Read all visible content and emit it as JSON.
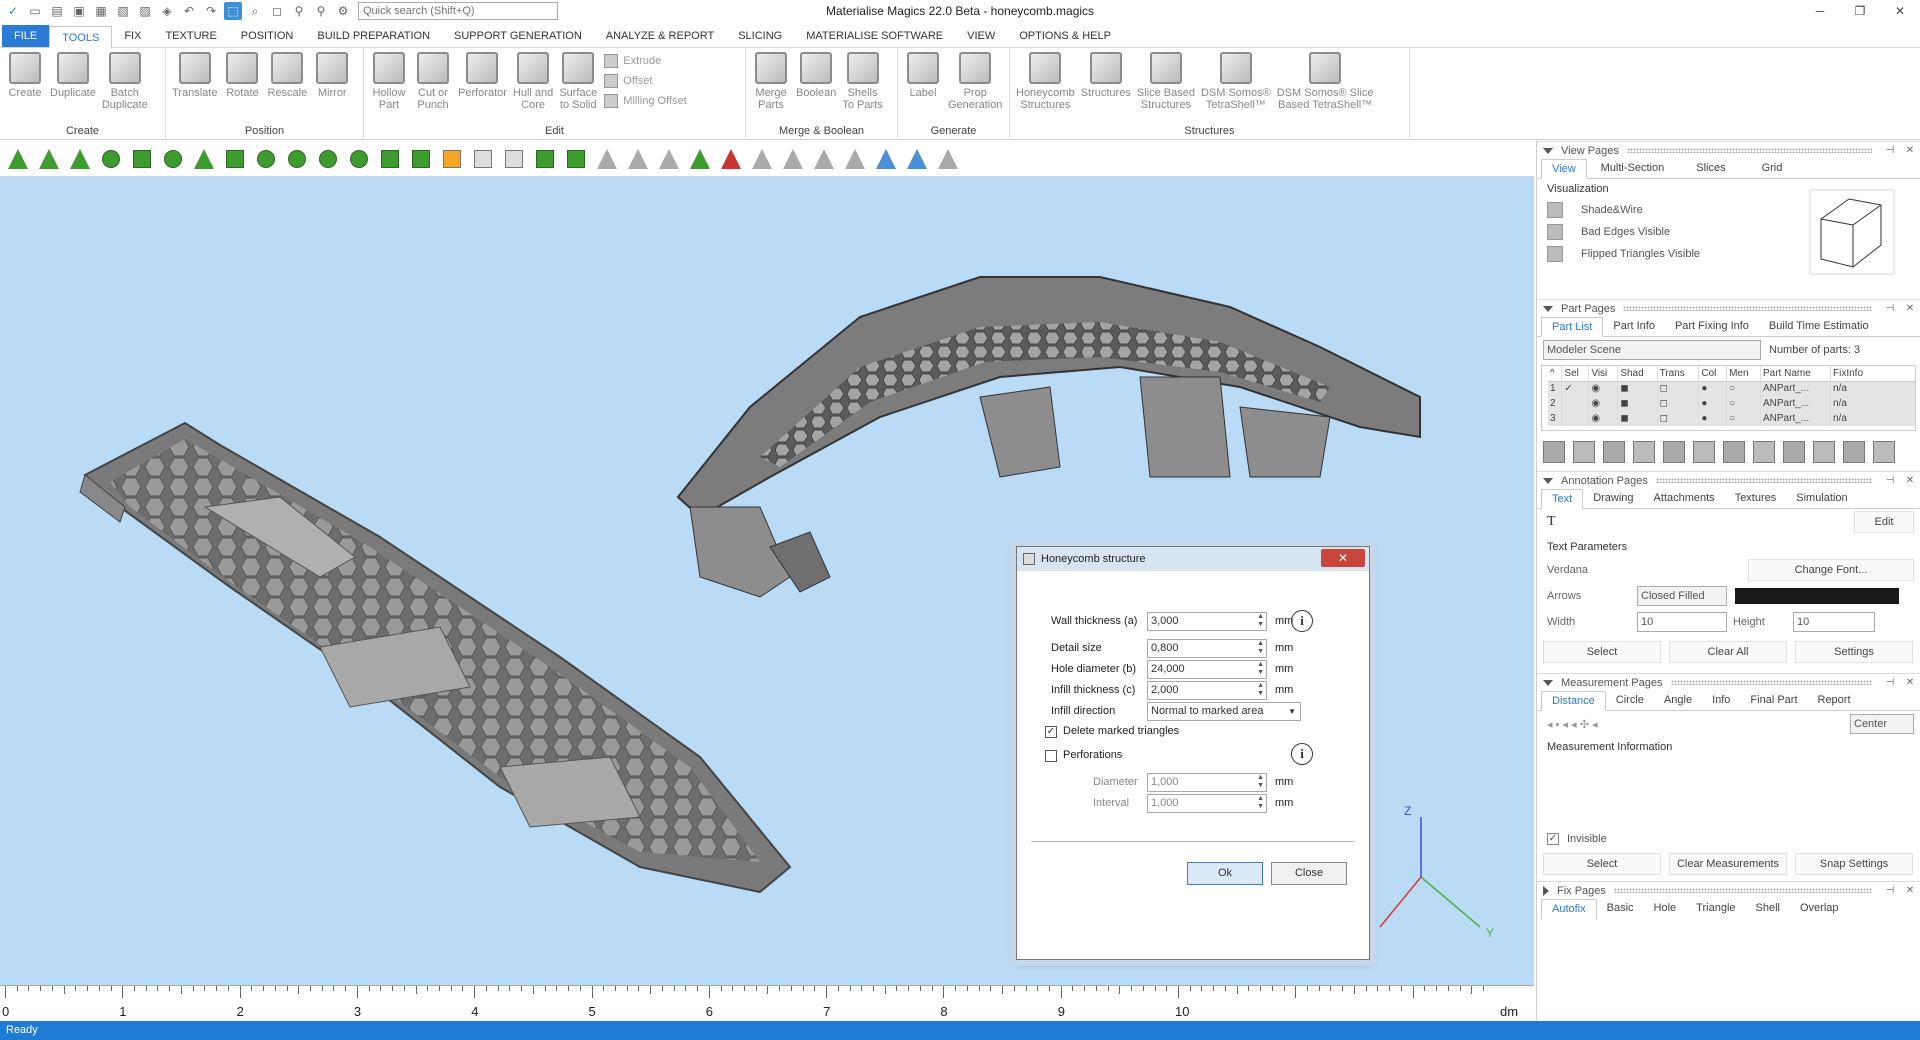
{
  "titlebar": {
    "title": "Materialise Magics 22.0 Beta - honeycomb.magics",
    "search_placeholder": "Quick search (Shift+Q)",
    "min": "─",
    "max": "❐",
    "close": "✕"
  },
  "menu": {
    "file": "FILE",
    "items": [
      "TOOLS",
      "FIX",
      "TEXTURE",
      "POSITION",
      "BUILD PREPARATION",
      "SUPPORT GENERATION",
      "ANALYZE & REPORT",
      "SLICING",
      "MATERIALISE SOFTWARE",
      "VIEW",
      "OPTIONS & HELP"
    ]
  },
  "ribbon": {
    "create": {
      "label": "Create",
      "buttons": [
        "Create",
        "Duplicate",
        "Batch\nDuplicate"
      ]
    },
    "position": {
      "label": "Position",
      "buttons": [
        "Translate",
        "Rotate",
        "Rescale",
        "Mirror"
      ]
    },
    "edit": {
      "label": "Edit",
      "buttons": [
        "Hollow\nPart",
        "Cut or\nPunch",
        "Perforator",
        "Hull and\nCore",
        "Surface\nto Solid"
      ],
      "small": [
        "Extrude",
        "Offset",
        "Milling Offset"
      ]
    },
    "merge": {
      "label": "Merge & Boolean",
      "buttons": [
        "Merge\nParts",
        "Boolean",
        "Shells\nTo Parts"
      ]
    },
    "generate": {
      "label": "Generate",
      "buttons": [
        "Label",
        "Prop\nGeneration"
      ]
    },
    "structures": {
      "label": "Structures",
      "buttons": [
        "Honeycomb\nStructures",
        "Structures",
        "Slice Based\nStructures",
        "DSM Somos®\nTetraShell™",
        "DSM Somos® Slice\nBased TetraShell™"
      ]
    }
  },
  "ruler": {
    "labels": [
      "0",
      "1",
      "2",
      "3",
      "4",
      "5",
      "6",
      "7",
      "8",
      "9",
      "10"
    ],
    "unit": "dm"
  },
  "axes": {
    "z": "Z",
    "y": "Y"
  },
  "status": "Ready",
  "view_pages": {
    "title": "View Pages",
    "tabs": [
      "View",
      "Multi-Section",
      "Slices",
      "Grid"
    ],
    "section": "Visualization",
    "items": [
      "Shade&Wire",
      "Bad Edges Visible",
      "Flipped Triangles Visible"
    ]
  },
  "part_pages": {
    "title": "Part Pages",
    "tabs": [
      "Part List",
      "Part Info",
      "Part Fixing Info",
      "Build Time Estimatio"
    ],
    "scene": "Modeler Scene",
    "count_label": "Number of parts: 3",
    "columns": [
      "Sel",
      "Visi",
      "Shad",
      "Trans",
      "Col",
      "Men",
      "Part Name",
      "FixInfo"
    ],
    "rows": [
      {
        "n": "1",
        "name": "ANPart_...",
        "fix": "n/a",
        "checked": "✓"
      },
      {
        "n": "2",
        "name": "ANPart_...",
        "fix": "n/a",
        "checked": ""
      },
      {
        "n": "3",
        "name": "ANPart_...",
        "fix": "n/a",
        "checked": ""
      }
    ]
  },
  "annotation_pages": {
    "title": "Annotation Pages",
    "tabs": [
      "Text",
      "Drawing",
      "Attachments",
      "Textures",
      "Simulation"
    ],
    "edit": "Edit",
    "text_params": "Text Parameters",
    "font": "Verdana",
    "change_font": "Change Font...",
    "arrows_label": "Arrows",
    "arrows_value": "Closed Filled",
    "arrow_color": "#1a1a1a",
    "width_label": "Width",
    "width_value": "10",
    "height_label": "Height",
    "height_value": "10",
    "buttons": [
      "Select",
      "Clear All",
      "Settings"
    ]
  },
  "measurement_pages": {
    "title": "Measurement Pages",
    "tabs": [
      "Distance",
      "Circle",
      "Angle",
      "Info",
      "Final Part",
      "Report"
    ],
    "center": "Center",
    "info_title": "Measurement Information",
    "invisible": "Invisible",
    "buttons": [
      "Select",
      "Clear Measurements",
      "Snap Settings"
    ]
  },
  "fix_pages": {
    "title": "Fix Pages",
    "tabs": [
      "Autofix",
      "Basic",
      "Hole",
      "Triangle",
      "Shell",
      "Overlap"
    ]
  },
  "dialog": {
    "title": "Honeycomb structure",
    "close": "✕",
    "wall_label": "Wall thickness (a)",
    "wall_value": "3,000",
    "detail_label": "Detail size",
    "detail_value": "0,800",
    "hole_label": "Hole diameter (b)",
    "hole_value": "24,000",
    "infill_label": "Infill thickness (c)",
    "infill_value": "2,000",
    "dir_label": "Infill direction",
    "dir_value": "Normal to marked area",
    "delete_label": "Delete marked triangles",
    "perf_label": "Perforations",
    "diam_label": "Diameter",
    "diam_value": "1,000",
    "interval_label": "Interval",
    "interval_value": "1,000",
    "unit": "mm",
    "ok": "Ok",
    "close_btn": "Close"
  }
}
